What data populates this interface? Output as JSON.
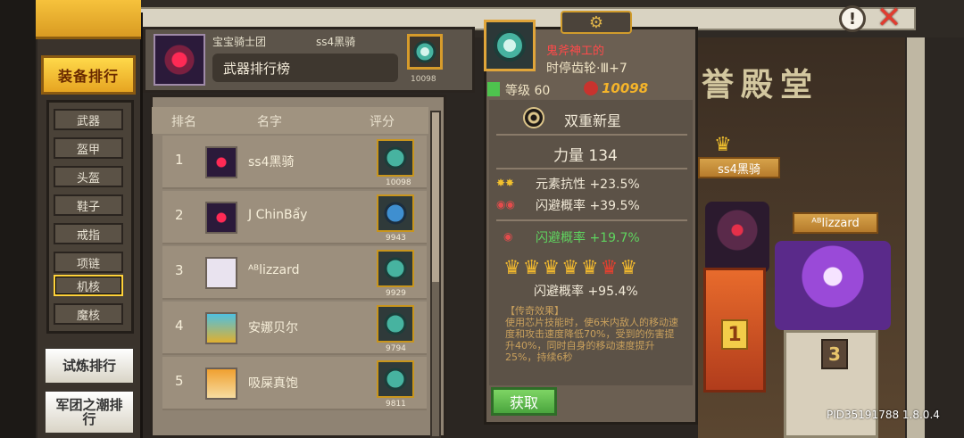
{
  "nav": {
    "main_tab": "装备排行",
    "categories": [
      "武器",
      "盔甲",
      "头盔",
      "鞋子",
      "戒指",
      "项链",
      "机核",
      "魔核"
    ],
    "active_category": "机核",
    "trial_tab": "试炼排行",
    "legion_tab": "军团之潮排行"
  },
  "header": {
    "guild": "宝宝骑士团",
    "player": "ss4黑骑",
    "title": "武器排行榜",
    "score": "10098"
  },
  "table": {
    "columns": [
      "排名",
      "名字",
      "评分"
    ],
    "rows": [
      {
        "rank": "1",
        "name": "ss4黑骑",
        "score": "10098"
      },
      {
        "rank": "2",
        "name": "J ChinBẩy",
        "score": "9943"
      },
      {
        "rank": "3",
        "name": "ᴬᴮlizzard",
        "score": "9929"
      },
      {
        "rank": "4",
        "name": "安娜贝尔",
        "score": "9794"
      },
      {
        "rank": "5",
        "name": "吸屎真饱",
        "score": "9811"
      }
    ]
  },
  "popup": {
    "subtitle": "鬼斧神工的",
    "weapon_name": "时停齿轮·Ⅲ+7",
    "level_label": "等级 60",
    "score": "10098",
    "skill_name": "双重新星",
    "power": "力量 134",
    "stats": [
      {
        "label": "元素抗性",
        "value": "+23.5%"
      },
      {
        "label": "闪避概率",
        "value": "+39.5%"
      }
    ],
    "bonus_stat": {
      "label": "闪避概率",
      "value": "+19.7%"
    },
    "crown_count": 7,
    "total_stat": "闪避概率 +95.4%",
    "legend_title": "【传奇效果】",
    "legend_desc": "使用芯片技能时，使6米内敌人的移动速度和攻击速度降低70%，受到的伤害提升40%，同时自身的移动速度提升25%，持续6秒",
    "get_button": "获取"
  },
  "hall": {
    "title": "誉殿堂",
    "first_name": "ss4黑骑",
    "third_name": "ᴬᴮlizzard",
    "first_rank": "1",
    "third_rank": "3"
  },
  "footer": {
    "pid": "PID35191788 1.8.0.4"
  },
  "colors": {
    "gold": "#f2b92e",
    "red_text": "#ff4a4a",
    "green_text": "#5fd45f",
    "panel": "#6b5f52"
  }
}
